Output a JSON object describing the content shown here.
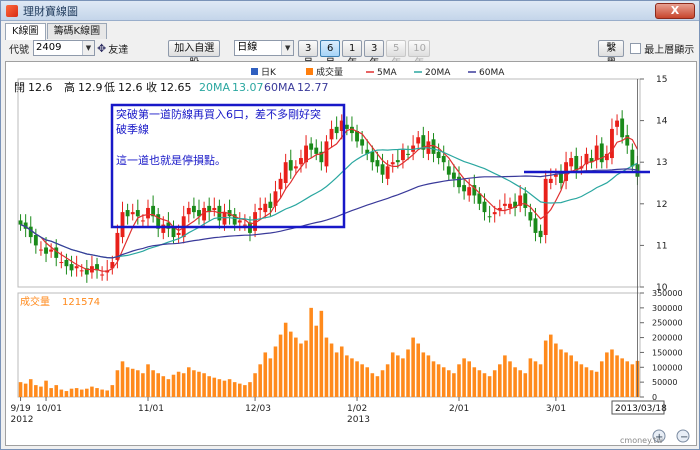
{
  "window": {
    "title": "理財寶線圖",
    "close_label": "X"
  },
  "tabs": [
    {
      "label": "K線圖",
      "active": true
    },
    {
      "label": "籌碼K線圖",
      "active": false
    }
  ],
  "toolbar": {
    "code_label": "代號",
    "code_value": "2409",
    "friend_label": "友達",
    "add_watchlist_label": "加入自選股",
    "period_value": "日線",
    "range_buttons": [
      {
        "label": "3月",
        "selected": false,
        "disabled": false
      },
      {
        "label": "6月",
        "selected": true,
        "disabled": false
      },
      {
        "label": "1年",
        "selected": false,
        "disabled": false
      },
      {
        "label": "3年",
        "selected": false,
        "disabled": false
      },
      {
        "label": "5年",
        "selected": false,
        "disabled": true
      },
      {
        "label": "10年",
        "selected": false,
        "disabled": true
      }
    ],
    "print_label": "繫黑",
    "topmost_label": "最上層顯示"
  },
  "legend": {
    "items": [
      {
        "label": "日K",
        "color": "#3060c0"
      },
      {
        "label": "成交量",
        "color": "#ff7f0e"
      },
      {
        "label": "5MA",
        "color": "#e03030"
      },
      {
        "label": "20MA",
        "color": "#2aa7a0"
      },
      {
        "label": "60MA",
        "color": "#3a3a9a"
      }
    ]
  },
  "ohlc": {
    "open_label": "開",
    "open": "12.6",
    "high_label": "高",
    "high": "12.9",
    "low_label": "低",
    "low": "12.6",
    "close_label": "收",
    "close": "12.65",
    "ma20_label": "20MA",
    "ma20": "13.07",
    "ma60_label": "60MA",
    "ma60": "12.77"
  },
  "annotation": {
    "line1": "突破第一道防線再買入6口，差不多剛好突",
    "line2": "破季線",
    "line3": "這一道也就是停損點。"
  },
  "volume_label": "成交量",
  "volume_value": "121574",
  "date_tooltip": "2013/03/18",
  "watermark": "cmoney.tw",
  "colors": {
    "up": "#e8201a",
    "down": "#1a8a1a",
    "volume": "#ff8a1c",
    "ma5": "#e03030",
    "ma20": "#2aa7a0",
    "ma60": "#3a3a9a",
    "box": "#1818c8"
  },
  "chart_data": [
    {
      "type": "candlestick",
      "title": "",
      "x_ticks": [
        "9/19",
        "10/01",
        "11/01",
        "12/03",
        "1/02",
        "2/01",
        "3/01"
      ],
      "x_tick_years": [
        "2012",
        "",
        "",
        "",
        "2013",
        "",
        ""
      ],
      "ylim": [
        10,
        15
      ],
      "y_ticks": [
        10,
        11,
        12,
        13,
        14,
        15
      ],
      "close": [
        11.5,
        11.4,
        11.2,
        11.0,
        10.9,
        10.8,
        10.9,
        10.7,
        10.6,
        10.5,
        10.4,
        10.5,
        10.4,
        10.3,
        10.5,
        10.4,
        10.3,
        10.4,
        10.6,
        11.3,
        11.8,
        11.7,
        11.8,
        11.7,
        11.6,
        11.9,
        11.7,
        11.4,
        11.5,
        11.4,
        11.2,
        11.3,
        11.7,
        11.9,
        11.8,
        11.7,
        11.9,
        11.8,
        11.9,
        11.6,
        11.8,
        11.7,
        11.5,
        11.6,
        11.5,
        11.3,
        11.8,
        11.9,
        12.0,
        11.9,
        12.3,
        12.6,
        13.0,
        12.8,
        12.9,
        13.1,
        13.4,
        13.3,
        13.2,
        13.0,
        13.5,
        13.8,
        13.7,
        14.0,
        13.8,
        13.7,
        13.5,
        13.4,
        13.2,
        13.0,
        12.9,
        12.7,
        12.9,
        13.0,
        13.0,
        13.3,
        13.2,
        13.4,
        13.6,
        13.3,
        13.5,
        13.2,
        13.1,
        13.0,
        12.7,
        12.6,
        12.4,
        12.3,
        12.4,
        12.2,
        12.0,
        11.8,
        11.7,
        11.8,
        11.9,
        12.0,
        12.0,
        11.9,
        12.2,
        11.9,
        11.6,
        11.3,
        11.2,
        12.6,
        12.6,
        12.7,
        12.5,
        13.0,
        13.1,
        12.8,
        12.9,
        13.2,
        13.0,
        13.4,
        13.0,
        13.2,
        13.8,
        14.0,
        13.6,
        13.4,
        12.9,
        12.65
      ],
      "volume": [
        50000,
        45000,
        60000,
        40000,
        35000,
        55000,
        30000,
        40000,
        25000,
        20000,
        28000,
        30000,
        25000,
        28000,
        35000,
        30000,
        25000,
        22000,
        40000,
        90000,
        120000,
        100000,
        95000,
        90000,
        80000,
        110000,
        90000,
        80000,
        70000,
        60000,
        75000,
        85000,
        80000,
        100000,
        90000,
        85000,
        80000,
        70000,
        65000,
        60000,
        55000,
        60000,
        50000,
        45000,
        40000,
        50000,
        80000,
        110000,
        150000,
        130000,
        170000,
        210000,
        250000,
        220000,
        200000,
        180000,
        190000,
        300000,
        240000,
        290000,
        200000,
        180000,
        150000,
        170000,
        140000,
        130000,
        120000,
        110000,
        100000,
        80000,
        70000,
        90000,
        110000,
        150000,
        140000,
        130000,
        160000,
        200000,
        180000,
        150000,
        140000,
        120000,
        110000,
        100000,
        90000,
        80000,
        110000,
        130000,
        120000,
        100000,
        90000,
        80000,
        70000,
        90000,
        110000,
        140000,
        120000,
        100000,
        90000,
        80000,
        130000,
        120000,
        110000,
        190000,
        210000,
        180000,
        160000,
        150000,
        140000,
        120000,
        110000,
        100000,
        90000,
        85000,
        120000,
        150000,
        160000,
        140000,
        130000,
        120000,
        110000,
        121574
      ],
      "volume_ylim": [
        0,
        350000
      ],
      "volume_ticks": [
        0,
        50000,
        100000,
        150000,
        200000,
        250000,
        300000,
        350000
      ]
    }
  ]
}
